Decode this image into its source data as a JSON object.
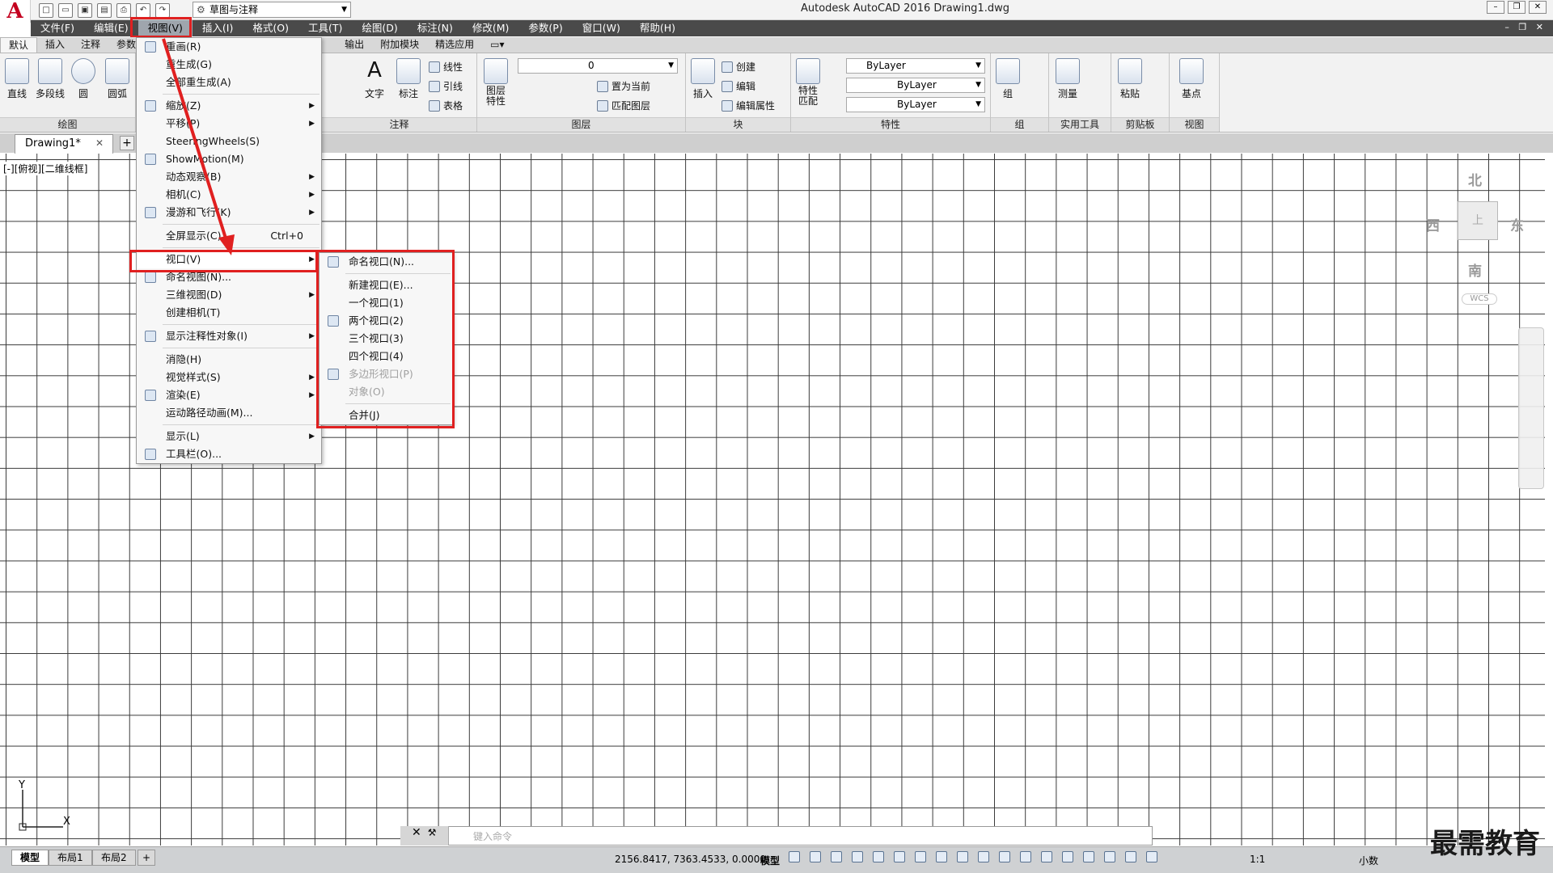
{
  "app": {
    "logo": "A",
    "window_title": "Autodesk AutoCAD 2016    Drawing1.dwg",
    "workspace": "草图与注释"
  },
  "menubar": [
    "文件(F)",
    "编辑(E)",
    "视图(V)",
    "插入(I)",
    "格式(O)",
    "工具(T)",
    "绘图(D)",
    "标注(N)",
    "修改(M)",
    "参数(P)",
    "窗口(W)",
    "帮助(H)"
  ],
  "ribbon_tabs": [
    "默认",
    "插入",
    "注释",
    "参数",
    "输出",
    "附加模块",
    "精选应用"
  ],
  "ribbon": {
    "draw": {
      "title": "绘图",
      "tools": [
        "直线",
        "多段线",
        "圆",
        "圆弧"
      ]
    },
    "annotation": {
      "title": "注释",
      "text": "文字",
      "dim": "标注",
      "linear": "线性",
      "leader": "引线",
      "table": "表格"
    },
    "layers": {
      "title": "图层",
      "props": "图层\n特性",
      "layer_value": "0",
      "make_current": "置为当前",
      "match": "匹配图层"
    },
    "block": {
      "title": "块",
      "insert": "插入",
      "create": "创建",
      "edit": "编辑",
      "edit_attr": "编辑属性"
    },
    "properties": {
      "title": "特性",
      "match": "特性\n匹配",
      "color": "ByLayer",
      "linetype": "ByLayer",
      "lineweight": "ByLayer"
    },
    "groups": {
      "title": "组",
      "group": "组"
    },
    "utilities": {
      "title": "实用工具",
      "measure": "测量"
    },
    "clipboard": {
      "title": "剪贴板",
      "paste": "粘贴"
    },
    "view": {
      "title": "视图",
      "base": "基点"
    }
  },
  "file_tab": "Drawing1*",
  "viewport_label": "[-][俯视][二维线框]",
  "viewcube": {
    "north": "北",
    "south": "南",
    "west": "西",
    "east": "东",
    "face": "上",
    "wcs": "WCS"
  },
  "view_menu": [
    {
      "label": "重画(R)"
    },
    {
      "label": "重生成(G)"
    },
    {
      "label": "全部重生成(A)",
      "sep_after": true
    },
    {
      "label": "缩放(Z)",
      "sub": true
    },
    {
      "label": "平移(P)",
      "sub": true
    },
    {
      "label": "SteeringWheels(S)"
    },
    {
      "label": "ShowMotion(M)"
    },
    {
      "label": "动态观察(B)",
      "sub": true
    },
    {
      "label": "相机(C)",
      "sub": true
    },
    {
      "label": "漫游和飞行(K)",
      "sub": true,
      "sep_after": true
    },
    {
      "label": "全屏显示(C)",
      "shortcut": "Ctrl+0",
      "sep_after": true
    },
    {
      "label": "视口(V)",
      "sub": true,
      "hl": true
    },
    {
      "label": "命名视图(N)..."
    },
    {
      "label": "三维视图(D)",
      "sub": true
    },
    {
      "label": "创建相机(T)",
      "sep_after": true
    },
    {
      "label": "显示注释性对象(I)",
      "sub": true,
      "sep_after": true
    },
    {
      "label": "消隐(H)"
    },
    {
      "label": "视觉样式(S)",
      "sub": true
    },
    {
      "label": "渲染(E)",
      "sub": true
    },
    {
      "label": "运动路径动画(M)...",
      "sep_after": true
    },
    {
      "label": "显示(L)",
      "sub": true
    },
    {
      "label": "工具栏(O)..."
    }
  ],
  "viewport_submenu": [
    {
      "label": "命名视口(N)...",
      "sep_after": true
    },
    {
      "label": "新建视口(E)..."
    },
    {
      "label": "一个视口(1)"
    },
    {
      "label": "两个视口(2)"
    },
    {
      "label": "三个视口(3)"
    },
    {
      "label": "四个视口(4)"
    },
    {
      "label": "多边形视口(P)",
      "disabled": true
    },
    {
      "label": "对象(O)",
      "disabled": true,
      "sep_after": true
    },
    {
      "label": "合并(J)"
    }
  ],
  "command": {
    "placeholder": "键入命令"
  },
  "status": {
    "layouts": [
      "模型",
      "布局1",
      "布局2"
    ],
    "coords": "2156.8417, 7363.4533, 0.0000",
    "mode": "模型",
    "scale": "1:1",
    "units": "小数"
  },
  "watermark": "最需教育",
  "colors": {
    "menubar": "#4a4a4a",
    "highlight": "#e02020",
    "logo": "#c4001f"
  }
}
